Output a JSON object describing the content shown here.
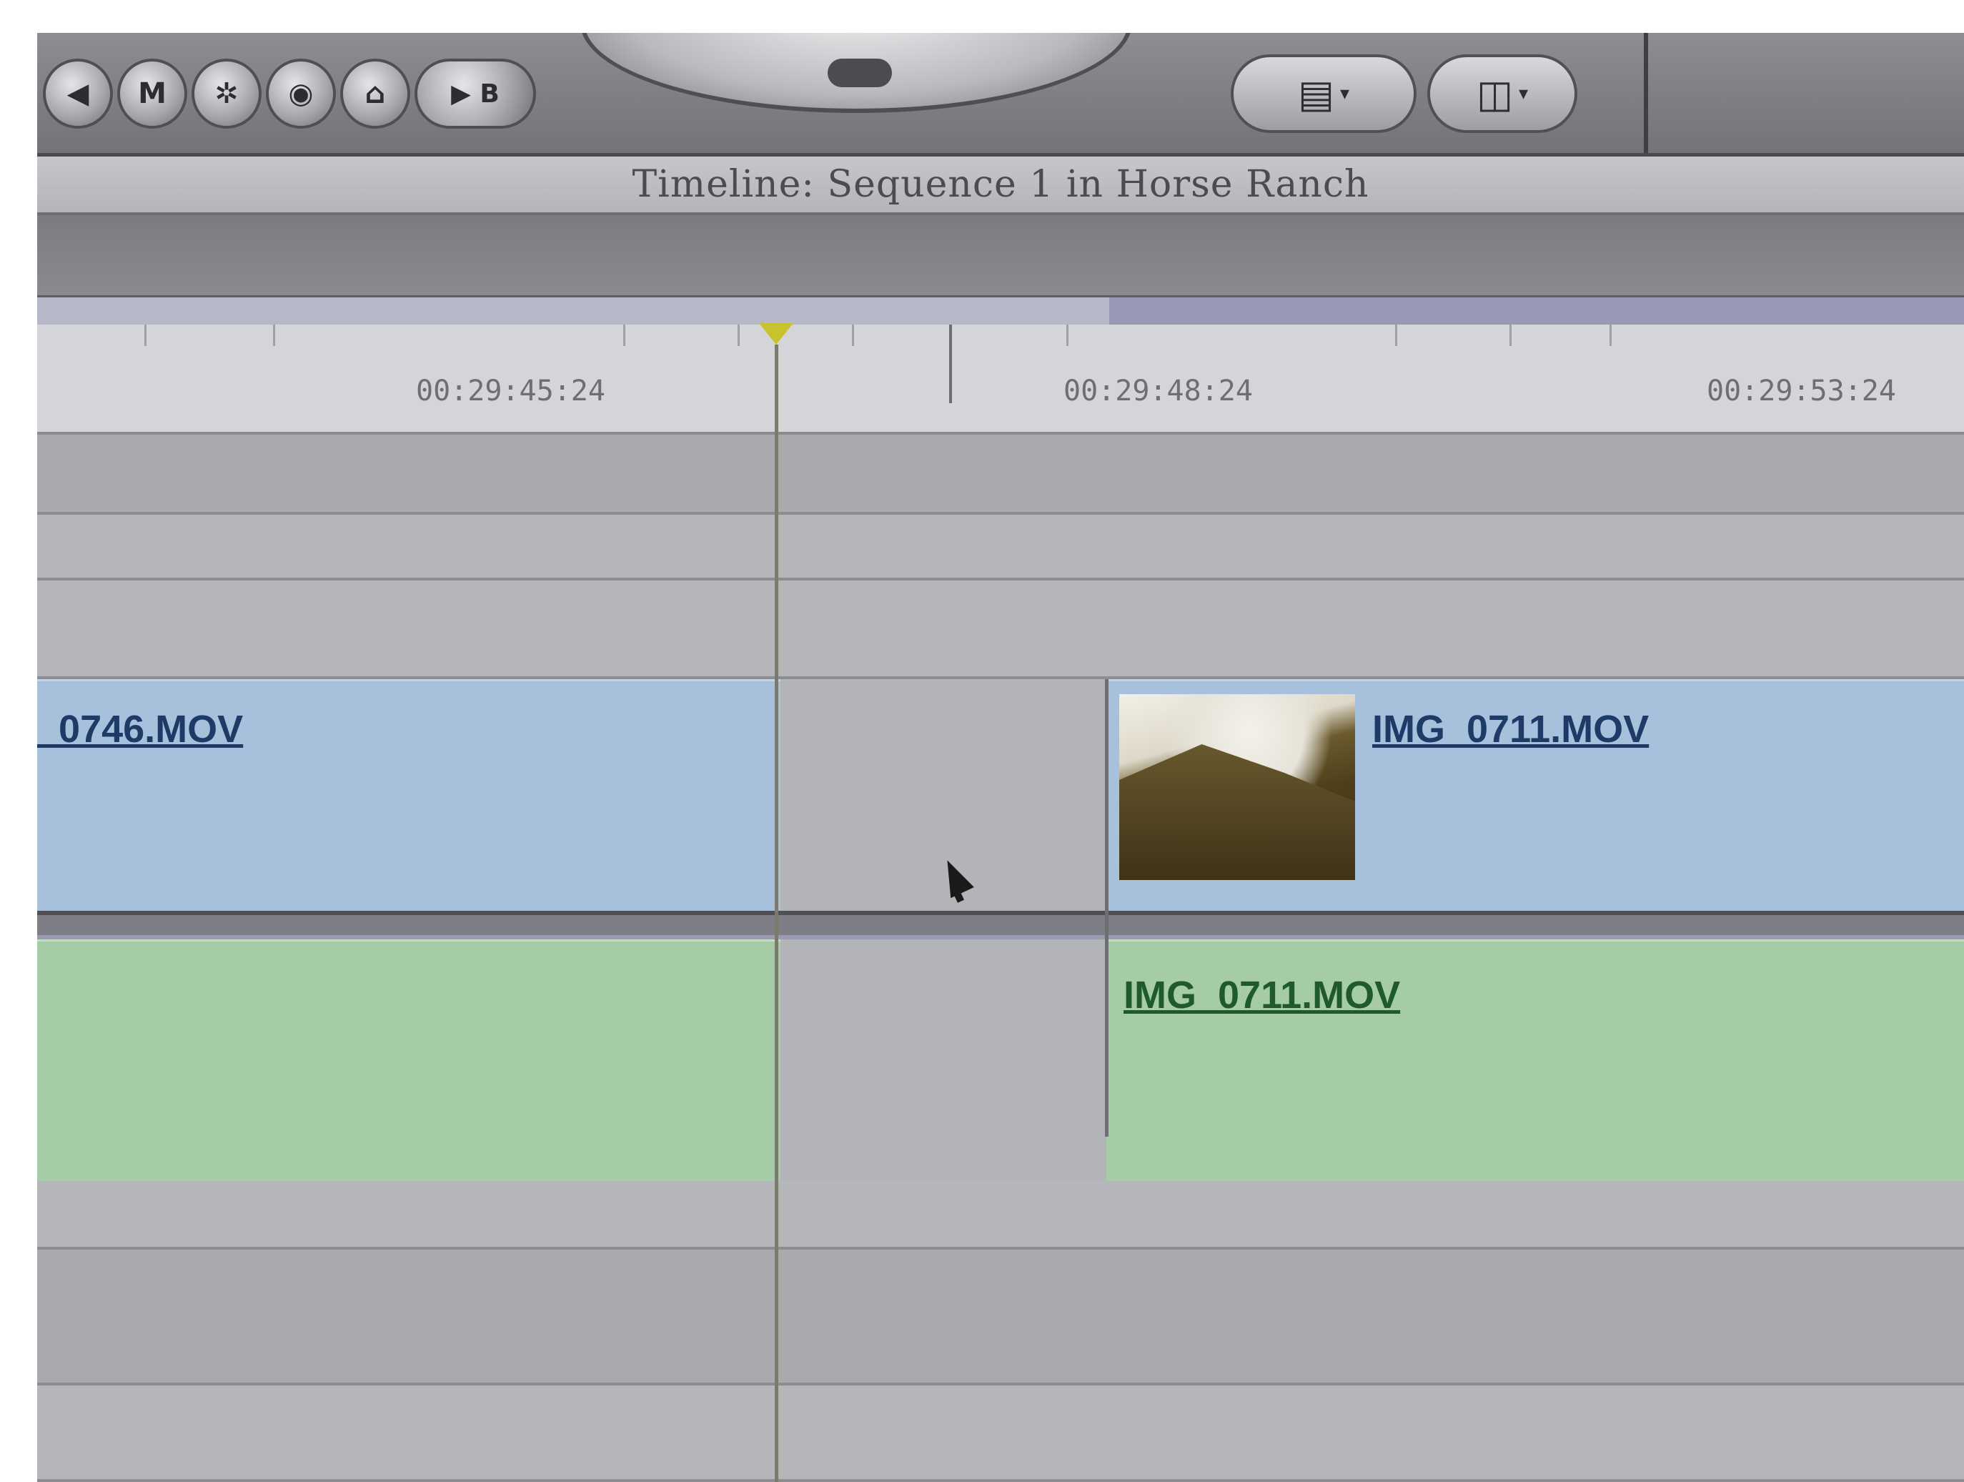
{
  "toolbar": {
    "buttons": [
      {
        "icon": "rewind-icon",
        "glyph": "◀"
      },
      {
        "icon": "mark-icon",
        "glyph": "M"
      },
      {
        "icon": "settings-icon",
        "glyph": "✲"
      },
      {
        "icon": "record-icon",
        "glyph": "◉"
      },
      {
        "icon": "home-icon",
        "glyph": "⌂"
      }
    ],
    "pill_button": {
      "icon": "match-frame-icon",
      "glyphs": "▶ B"
    },
    "view_popup": {
      "icon": "clip-view-icon",
      "glyph": "▤",
      "caret": "▾"
    },
    "layout_popup": {
      "icon": "layout-icon",
      "glyph": "◫",
      "caret": "▾"
    }
  },
  "title": "Timeline: Sequence 1 in Horse Ranch",
  "ruler": {
    "timecodes": [
      "00:29:45:24",
      "00:29:48:24",
      "00:29:53:24"
    ]
  },
  "tracks": {
    "video_clip_left": "_0746.MOV",
    "video_clip_right": "IMG_0711.MOV",
    "audio_clip_right": "IMG_0711.MOV"
  },
  "colors": {
    "video_clip": "#a7c1dd",
    "audio_clip": "#a6cba7",
    "playhead_marker": "#c9c22f"
  }
}
